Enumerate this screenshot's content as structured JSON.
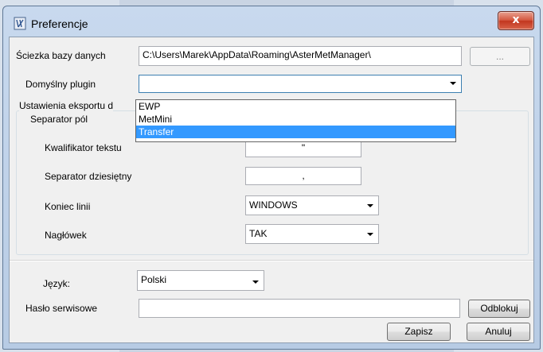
{
  "window": {
    "title": "Preferencje",
    "close_glyph": "x"
  },
  "database": {
    "label": "Ściezka bazy danych",
    "path": "C:\\Users\\Marek\\AppData\\Roaming\\AsterMetManager\\",
    "browse_label": "..."
  },
  "plugin": {
    "label": "Domyślny plugin",
    "value": "",
    "options": [
      "EWP",
      "MetMini",
      "Transfer"
    ],
    "highlighted": "Transfer"
  },
  "export": {
    "group_label": "Ustawienia eksportu d",
    "field_separator_label": "Separator pól",
    "text_qualifier_label": "Kwalifikator tekstu",
    "text_qualifier_value": "\"",
    "decimal_separator_label": "Separator dziesiętny",
    "decimal_separator_value": ",",
    "line_end_label": "Koniec linii",
    "line_end_value": "WINDOWS",
    "header_label": "Nagłówek",
    "header_value": "TAK"
  },
  "language": {
    "label": "Język:",
    "value": "Polski"
  },
  "service_password": {
    "label": "Hasło serwisowe",
    "value": "",
    "unlock_label": "Odblokuj"
  },
  "footer": {
    "save_label": "Zapisz",
    "cancel_label": "Anuluj"
  },
  "colors": {
    "selection": "#3399ff",
    "close_button": "#c9432c",
    "titlebar": "#c3d5ec"
  }
}
